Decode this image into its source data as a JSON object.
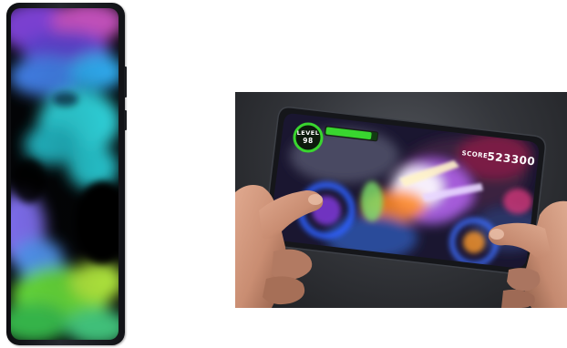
{
  "hud": {
    "level_label": "LEVEL",
    "level_value": "98",
    "score_label": "SCORE",
    "score_value": "523300"
  },
  "colors": {
    "page_background": "#ffffff",
    "photo_background": "#3a3c41",
    "phone_frame": "#1c1e22",
    "hud_green": "#39d52f",
    "accent_blue": "#2f5fff",
    "accent_purple": "#8e3cf0"
  }
}
